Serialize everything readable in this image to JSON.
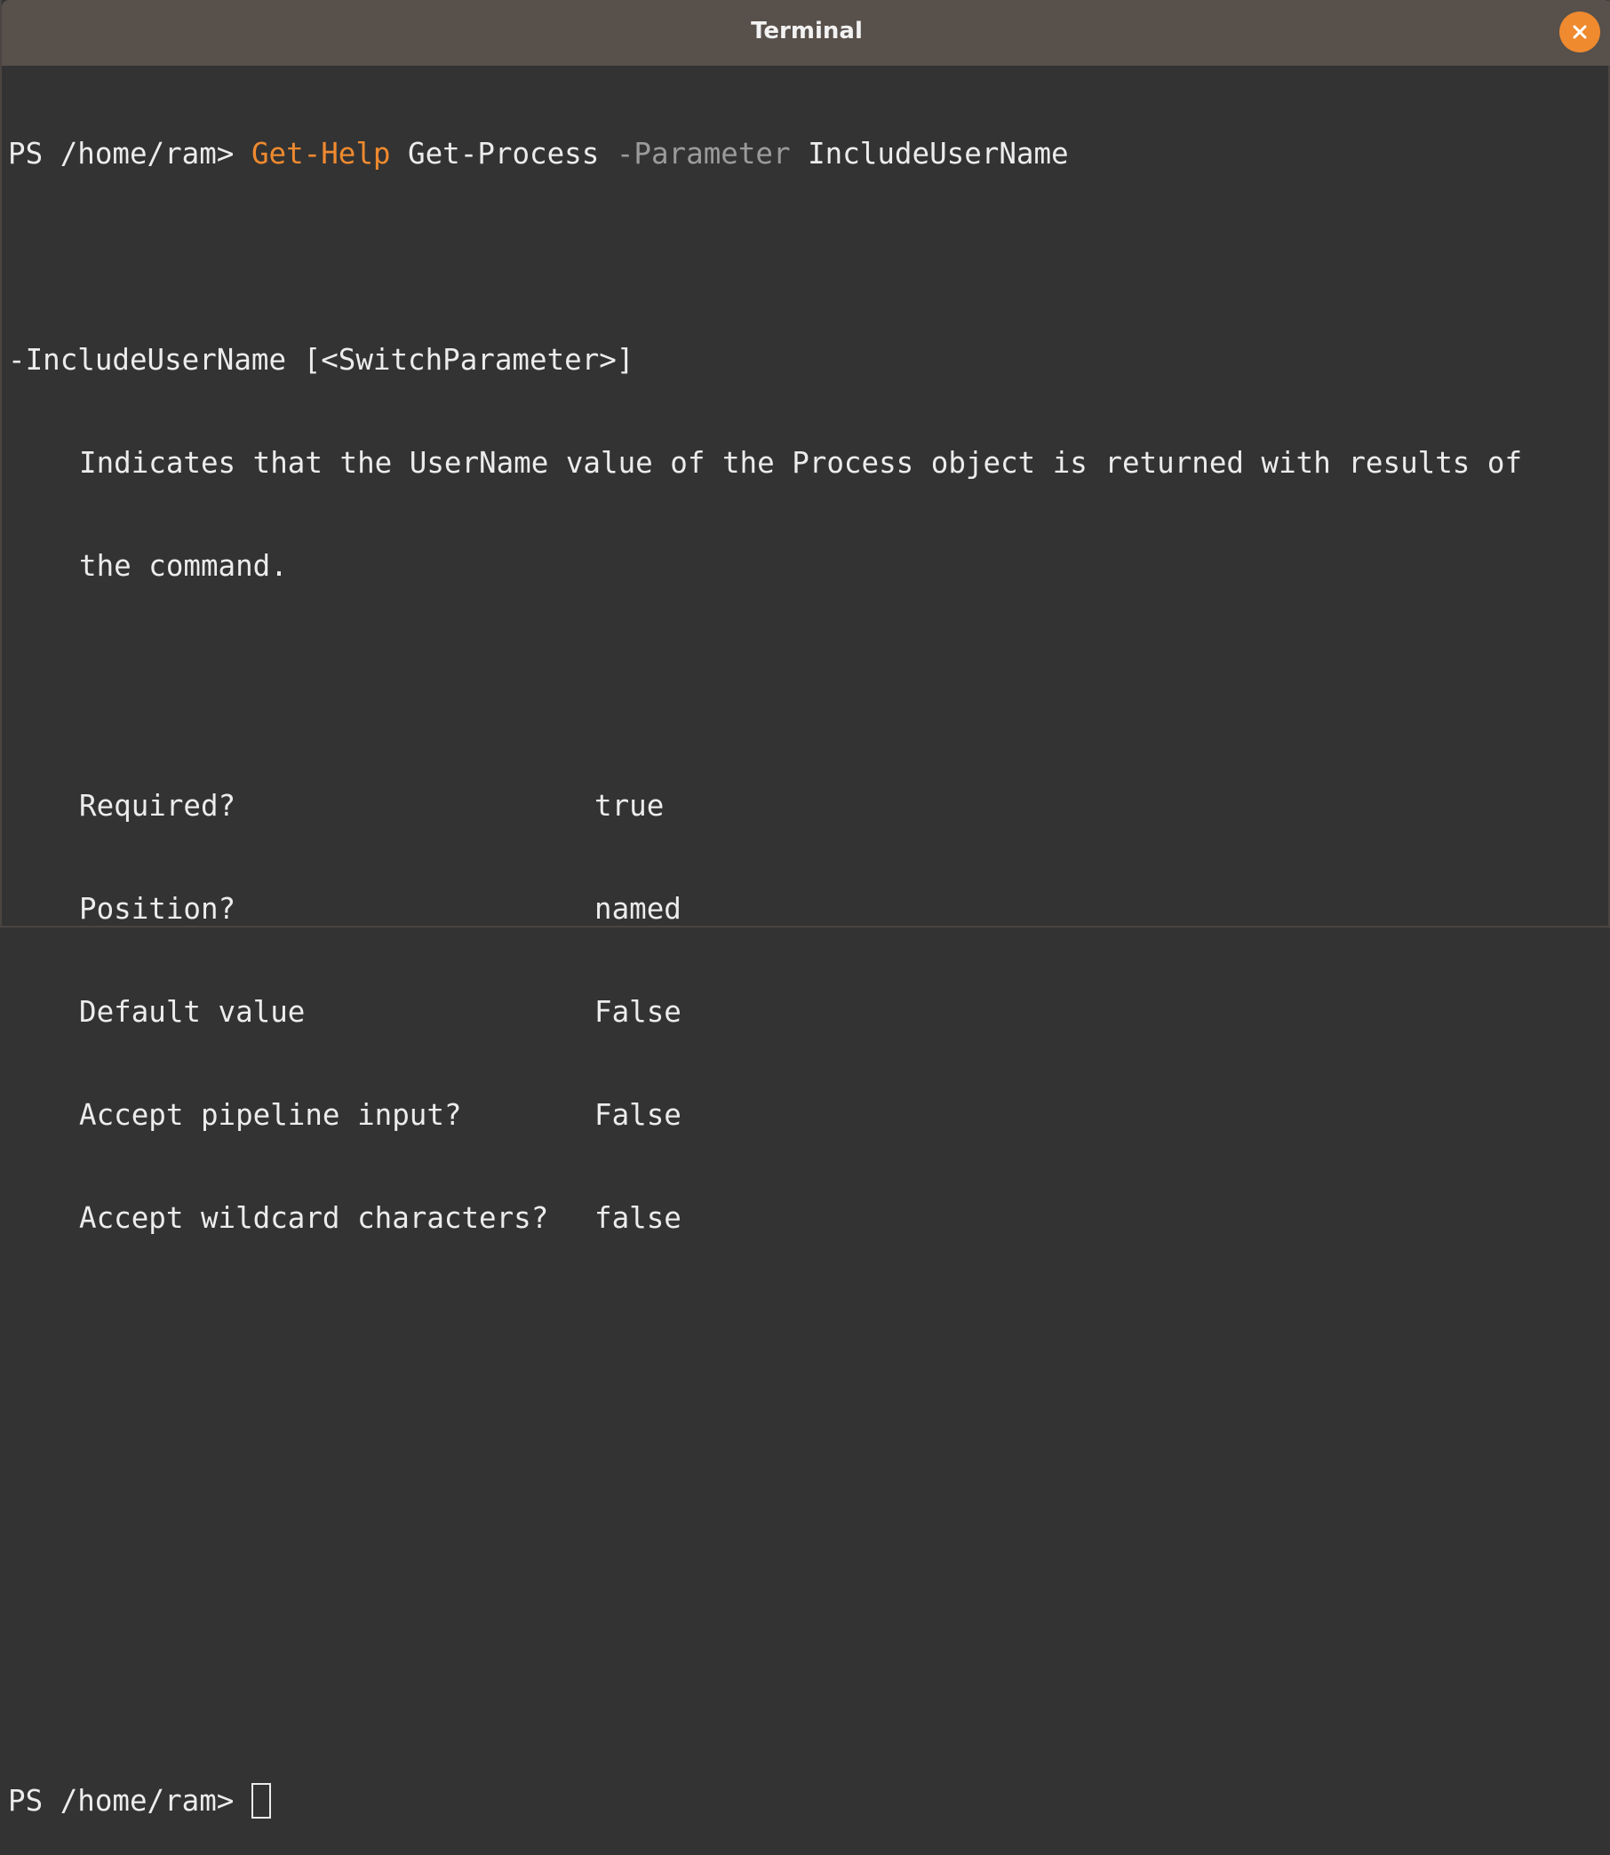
{
  "window": {
    "title": "Terminal",
    "close_icon": "close-icon",
    "accent_color": "#ef8a2f"
  },
  "terminal": {
    "command_line": {
      "prompt": "PS /home/ram> ",
      "cmdlet": "Get-Help",
      "arg1": " Get-Process ",
      "param_flag": "-Parameter",
      "param_value": " IncludeUserName"
    },
    "param_header": "-IncludeUserName [<SwitchParameter>]",
    "description": [
      "Indicates that the UserName value of the Process object is returned with results of",
      "the command."
    ],
    "properties": [
      {
        "label": "Required?",
        "value": "true"
      },
      {
        "label": "Position?",
        "value": "named"
      },
      {
        "label": "Default value",
        "value": "False"
      },
      {
        "label": "Accept pipeline input?",
        "value": "False"
      },
      {
        "label": "Accept wildcard characters?",
        "value": "false"
      }
    ],
    "final_prompt": "PS /home/ram> "
  }
}
